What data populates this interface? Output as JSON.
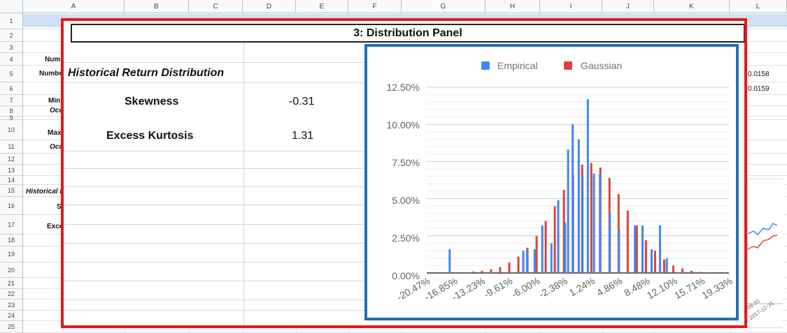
{
  "sheet": {
    "columns": [
      "A",
      "B",
      "C",
      "D",
      "E",
      "F",
      "G",
      "H",
      "I",
      "J",
      "K",
      "L"
    ],
    "rows": [
      "1",
      "2",
      "3",
      "4",
      "5",
      "6",
      "7",
      "8",
      "9",
      "10",
      "11",
      "12",
      "13",
      "14",
      "15",
      "16",
      "17",
      "18",
      "19",
      "20",
      "21",
      "22",
      "23",
      "24",
      "25"
    ],
    "bg_labels": {
      "r4": "Num",
      "r5": "Numbe",
      "r7": "Min",
      "r8": "Occ",
      "r10": "Max",
      "r11": "Occ",
      "r15": "Historical I",
      "r16": "S",
      "r17": "Exce"
    },
    "bg_values": {
      "r5": "0.0158",
      "r6": "0.0159"
    },
    "bg_dates": [
      "08-31",
      "2017-12-31"
    ]
  },
  "panel": {
    "title": "3: Distribution Panel",
    "section_title": "Historical Return Distribution",
    "stats": [
      {
        "label": "Skewness",
        "value": "-0.31"
      },
      {
        "label": "Excess Kurtosis",
        "value": "1.31"
      }
    ]
  },
  "colors": {
    "panel_border": "#e8181c",
    "chart_border": "#1f6fb5",
    "empirical": "#4285f4",
    "gaussian": "#db4437"
  },
  "chart_data": {
    "type": "bar",
    "legend_position": "top",
    "series": [
      {
        "name": "Empirical",
        "color": "#4285f4"
      },
      {
        "name": "Gaussian",
        "color": "#db4437"
      }
    ],
    "y_ticks": [
      "12.50%",
      "10.00%",
      "7.50%",
      "5.00%",
      "2.50%",
      "0.00%"
    ],
    "ylim": [
      0,
      12.5
    ],
    "x_ticks": [
      "-20.47%",
      "-16.85%",
      "-13.23%",
      "-9.61%",
      "-6.00%",
      "-2.38%",
      "1.24%",
      "4.86%",
      "8.48%",
      "12.10%",
      "15.71%",
      "19.33%"
    ],
    "xlim": [
      -20.47,
      19.33
    ],
    "empirical": [
      {
        "x": -17.8,
        "y": 1.6
      },
      {
        "x": -8.1,
        "y": 1.5
      },
      {
        "x": -7.6,
        "y": 1.6
      },
      {
        "x": -6.6,
        "y": 1.6
      },
      {
        "x": -5.6,
        "y": 3.2
      },
      {
        "x": -4.4,
        "y": 2.0
      },
      {
        "x": -3.5,
        "y": 4.9
      },
      {
        "x": -2.6,
        "y": 3.4
      },
      {
        "x": -2.2,
        "y": 8.3
      },
      {
        "x": -1.6,
        "y": 10.0
      },
      {
        "x": -0.8,
        "y": 9.0
      },
      {
        "x": -0.3,
        "y": 6.5
      },
      {
        "x": 0.4,
        "y": 11.7
      },
      {
        "x": 1.2,
        "y": 6.7
      },
      {
        "x": 2.0,
        "y": 6.7
      },
      {
        "x": 3.3,
        "y": 4.0
      },
      {
        "x": 4.5,
        "y": 2.9
      },
      {
        "x": 6.6,
        "y": 3.2
      },
      {
        "x": 7.6,
        "y": 3.2
      },
      {
        "x": 8.8,
        "y": 1.6
      },
      {
        "x": 9.9,
        "y": 3.2
      },
      {
        "x": 10.8,
        "y": 1.0
      }
    ],
    "gaussian": [
      {
        "x": -15.5,
        "y": 0.05
      },
      {
        "x": -14.3,
        "y": 0.1
      },
      {
        "x": -13.2,
        "y": 0.15
      },
      {
        "x": -12.0,
        "y": 0.25
      },
      {
        "x": -10.8,
        "y": 0.4
      },
      {
        "x": -9.6,
        "y": 0.7
      },
      {
        "x": -8.4,
        "y": 1.1
      },
      {
        "x": -7.2,
        "y": 1.7
      },
      {
        "x": -6.0,
        "y": 2.5
      },
      {
        "x": -4.8,
        "y": 3.5
      },
      {
        "x": -3.6,
        "y": 4.5
      },
      {
        "x": -2.4,
        "y": 5.6
      },
      {
        "x": -1.2,
        "y": 6.6
      },
      {
        "x": 0.0,
        "y": 7.3
      },
      {
        "x": 1.2,
        "y": 7.4
      },
      {
        "x": 2.4,
        "y": 7.1
      },
      {
        "x": 3.6,
        "y": 6.4
      },
      {
        "x": 4.8,
        "y": 5.3
      },
      {
        "x": 6.0,
        "y": 4.2
      },
      {
        "x": 7.2,
        "y": 3.2
      },
      {
        "x": 8.4,
        "y": 2.2
      },
      {
        "x": 9.6,
        "y": 1.5
      },
      {
        "x": 10.8,
        "y": 0.9
      },
      {
        "x": 12.0,
        "y": 0.5
      },
      {
        "x": 13.2,
        "y": 0.3
      },
      {
        "x": 14.4,
        "y": 0.15
      },
      {
        "x": 15.6,
        "y": 0.07
      },
      {
        "x": 16.8,
        "y": 0.03
      }
    ]
  }
}
